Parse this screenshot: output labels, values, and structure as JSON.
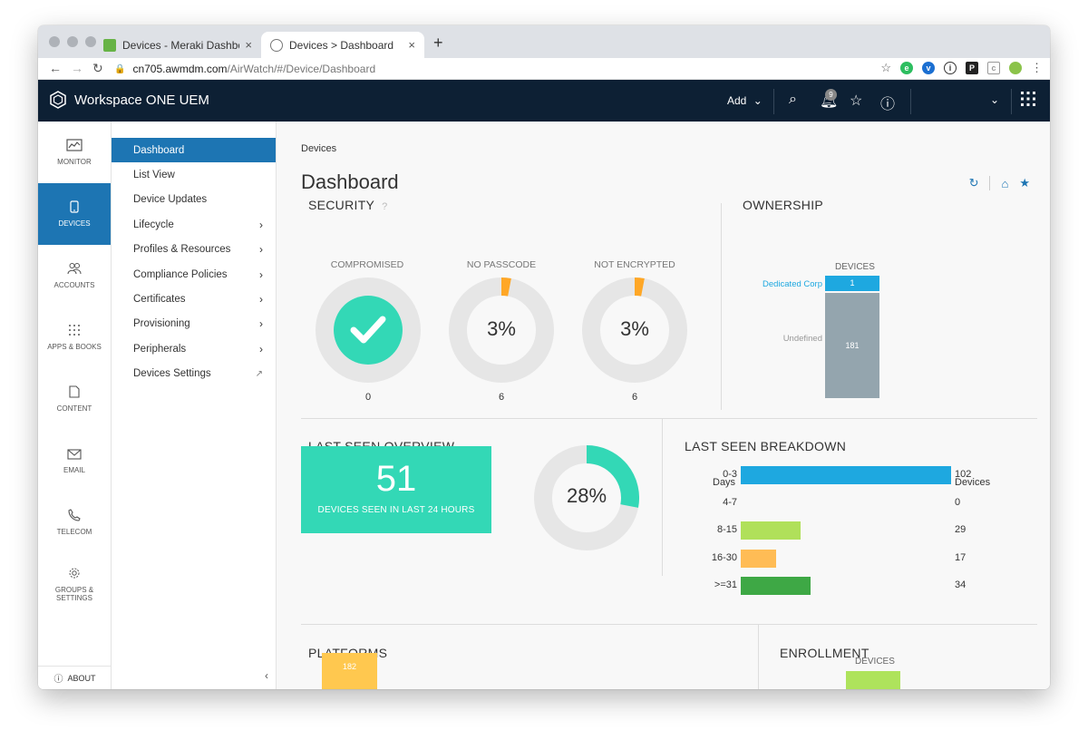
{
  "browser": {
    "tabs": [
      {
        "title": "Devices - Meraki Dashboard",
        "favicon_color": "#67b346"
      },
      {
        "title": "Devices > Dashboard",
        "favicon_color": "#888888"
      }
    ],
    "url_host": "cn705.awmdm.com",
    "url_path": "/AirWatch/#/Device/Dashboard",
    "close_glyph": "×",
    "new_tab_glyph": "+",
    "extensions": [
      "evernote-icon",
      "vivaldi-icon",
      "info-icon",
      "p-icon",
      "clipboard-icon",
      "avatar-icon",
      "menu-dots-icon"
    ]
  },
  "header": {
    "brand": "Workspace ONE UEM",
    "add_label": "Add",
    "notification_count": "9",
    "colors": {
      "background": "#0d2034"
    }
  },
  "rail": {
    "items": [
      {
        "label": "MONITOR",
        "icon": "monitor-icon"
      },
      {
        "label": "DEVICES",
        "icon": "phone-icon"
      },
      {
        "label": "ACCOUNTS",
        "icon": "people-icon"
      },
      {
        "label": "APPS & BOOKS",
        "icon": "grid-dots-icon"
      },
      {
        "label": "CONTENT",
        "icon": "document-icon"
      },
      {
        "label": "EMAIL",
        "icon": "envelope-icon"
      },
      {
        "label": "TELECOM",
        "icon": "phone-handset-icon"
      },
      {
        "label": "GROUPS &",
        "label2": "SETTINGS",
        "icon": "gear-icon"
      }
    ],
    "active": "DEVICES",
    "about": "ABOUT"
  },
  "subnav": {
    "items": [
      {
        "label": "Dashboard"
      },
      {
        "label": "List View"
      },
      {
        "label": "Device Updates"
      },
      {
        "label": "Lifecycle",
        "chevron": true
      },
      {
        "label": "Profiles & Resources",
        "chevron": true
      },
      {
        "label": "Compliance Policies",
        "chevron": true
      },
      {
        "label": "Certificates",
        "chevron": true
      },
      {
        "label": "Provisioning",
        "chevron": true
      },
      {
        "label": "Peripherals",
        "chevron": true
      },
      {
        "label": "Devices Settings",
        "external": true
      }
    ],
    "active": "Dashboard"
  },
  "page": {
    "breadcrumb": "Devices",
    "title": "Dashboard"
  },
  "security": {
    "title": "SECURITY",
    "gauges": [
      {
        "label": "COMPROMISED",
        "count": "0",
        "percent": 0,
        "display": ""
      },
      {
        "label": "NO PASSCODE",
        "count": "6",
        "percent": 3,
        "display": "3%"
      },
      {
        "label": "NOT ENCRYPTED",
        "count": "6",
        "percent": 3,
        "display": "3%"
      }
    ],
    "colors": {
      "ok": "#33d8b6",
      "warn": "#ffa726",
      "track": "#e6e6e6"
    }
  },
  "ownership": {
    "title": "OWNERSHIP",
    "column": "DEVICES",
    "rows": [
      {
        "label": "Dedicated Corp",
        "value": 1,
        "color": "#1ea8e0"
      },
      {
        "label": "Undefined",
        "value": 181,
        "color": "#94a5ae"
      }
    ]
  },
  "last_seen_overview": {
    "title": "LAST SEEN OVERVIEW",
    "count": "51",
    "caption": "DEVICES SEEN IN LAST 24 HOURS",
    "percent": 28,
    "percent_label": "28%"
  },
  "last_seen_breakdown": {
    "title": "LAST SEEN BREAKDOWN",
    "days_header": "Days",
    "devices_header": "Devices",
    "rows": [
      {
        "days": "0-3",
        "value": 102,
        "color": "#1ea8e0"
      },
      {
        "days": "4-7",
        "value": 0,
        "color": "#1ea8e0"
      },
      {
        "days": "8-15",
        "value": 29,
        "color": "#b0e05a"
      },
      {
        "days": "16-30",
        "value": 17,
        "color": "#ffbc55"
      },
      {
        "days": ">=31",
        "value": 34,
        "color": "#3ea845"
      }
    ]
  },
  "platforms": {
    "title": "PLATFORMS",
    "bar_value": "182"
  },
  "enrollment": {
    "title": "ENROLLMENT",
    "column": "DEVICES"
  }
}
